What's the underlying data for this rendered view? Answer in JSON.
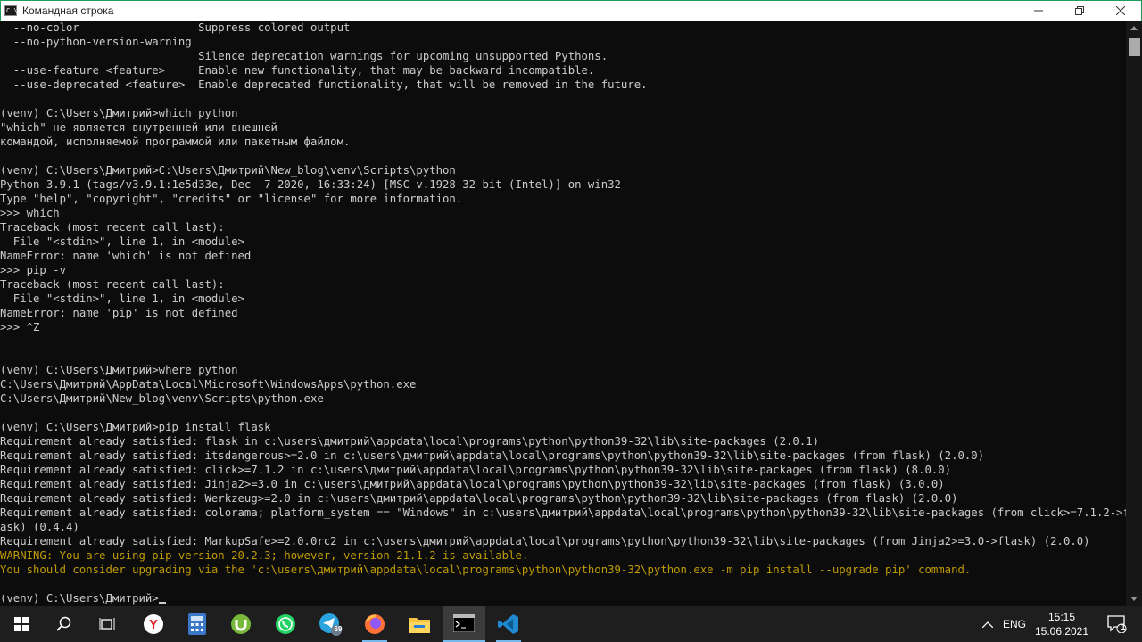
{
  "window": {
    "title": "Командная строка",
    "app_icon_text": "C:\\"
  },
  "terminal": {
    "lines": [
      {
        "text": "  --no-color                  Suppress colored output",
        "color": "#cccccc"
      },
      {
        "text": "  --no-python-version-warning",
        "color": "#cccccc"
      },
      {
        "text": "                              Silence deprecation warnings for upcoming unsupported Pythons.",
        "color": "#cccccc"
      },
      {
        "text": "  --use-feature <feature>     Enable new functionality, that may be backward incompatible.",
        "color": "#cccccc"
      },
      {
        "text": "  --use-deprecated <feature>  Enable deprecated functionality, that will be removed in the future.",
        "color": "#cccccc"
      },
      {
        "text": "",
        "color": "#cccccc"
      },
      {
        "text": "(venv) C:\\Users\\Дмитрий>which python",
        "color": "#cccccc"
      },
      {
        "text": "\"which\" не является внутренней или внешней",
        "color": "#cccccc"
      },
      {
        "text": "командой, исполняемой программой или пакетным файлом.",
        "color": "#cccccc"
      },
      {
        "text": "",
        "color": "#cccccc"
      },
      {
        "text": "(venv) C:\\Users\\Дмитрий>C:\\Users\\Дмитрий\\New_blog\\venv\\Scripts\\python",
        "color": "#cccccc"
      },
      {
        "text": "Python 3.9.1 (tags/v3.9.1:1e5d33e, Dec  7 2020, 16:33:24) [MSC v.1928 32 bit (Intel)] on win32",
        "color": "#cccccc"
      },
      {
        "text": "Type \"help\", \"copyright\", \"credits\" or \"license\" for more information.",
        "color": "#cccccc"
      },
      {
        "text": ">>> which",
        "color": "#cccccc"
      },
      {
        "text": "Traceback (most recent call last):",
        "color": "#cccccc"
      },
      {
        "text": "  File \"<stdin>\", line 1, in <module>",
        "color": "#cccccc"
      },
      {
        "text": "NameError: name 'which' is not defined",
        "color": "#cccccc"
      },
      {
        "text": ">>> pip -v",
        "color": "#cccccc"
      },
      {
        "text": "Traceback (most recent call last):",
        "color": "#cccccc"
      },
      {
        "text": "  File \"<stdin>\", line 1, in <module>",
        "color": "#cccccc"
      },
      {
        "text": "NameError: name 'pip' is not defined",
        "color": "#cccccc"
      },
      {
        "text": ">>> ^Z",
        "color": "#cccccc"
      },
      {
        "text": "",
        "color": "#cccccc"
      },
      {
        "text": "",
        "color": "#cccccc"
      },
      {
        "text": "(venv) C:\\Users\\Дмитрий>where python",
        "color": "#cccccc"
      },
      {
        "text": "C:\\Users\\Дмитрий\\AppData\\Local\\Microsoft\\WindowsApps\\python.exe",
        "color": "#cccccc"
      },
      {
        "text": "C:\\Users\\Дмитрий\\New_blog\\venv\\Scripts\\python.exe",
        "color": "#cccccc"
      },
      {
        "text": "",
        "color": "#cccccc"
      },
      {
        "text": "(venv) C:\\Users\\Дмитрий>pip install flask",
        "color": "#cccccc"
      },
      {
        "text": "Requirement already satisfied: flask in c:\\users\\дмитрий\\appdata\\local\\programs\\python\\python39-32\\lib\\site-packages (2.0.1)",
        "color": "#cccccc"
      },
      {
        "text": "Requirement already satisfied: itsdangerous>=2.0 in c:\\users\\дмитрий\\appdata\\local\\programs\\python\\python39-32\\lib\\site-packages (from flask) (2.0.0)",
        "color": "#cccccc"
      },
      {
        "text": "Requirement already satisfied: click>=7.1.2 in c:\\users\\дмитрий\\appdata\\local\\programs\\python\\python39-32\\lib\\site-packages (from flask) (8.0.0)",
        "color": "#cccccc"
      },
      {
        "text": "Requirement already satisfied: Jinja2>=3.0 in c:\\users\\дмитрий\\appdata\\local\\programs\\python\\python39-32\\lib\\site-packages (from flask) (3.0.0)",
        "color": "#cccccc"
      },
      {
        "text": "Requirement already satisfied: Werkzeug>=2.0 in c:\\users\\дмитрий\\appdata\\local\\programs\\python\\python39-32\\lib\\site-packages (from flask) (2.0.0)",
        "color": "#cccccc"
      },
      {
        "text": "Requirement already satisfied: colorama; platform_system == \"Windows\" in c:\\users\\дмитрий\\appdata\\local\\programs\\python\\python39-32\\lib\\site-packages (from click>=7.1.2->fl",
        "color": "#cccccc"
      },
      {
        "text": "ask) (0.4.4)",
        "color": "#cccccc"
      },
      {
        "text": "Requirement already satisfied: MarkupSafe>=2.0.0rc2 in c:\\users\\дмитрий\\appdata\\local\\programs\\python\\python39-32\\lib\\site-packages (from Jinja2>=3.0->flask) (2.0.0)",
        "color": "#cccccc"
      },
      {
        "text": "WARNING: You are using pip version 20.2.3; however, version 21.1.2 is available.",
        "color": "#c19c00"
      },
      {
        "text": "You should consider upgrading via the 'c:\\users\\дмитрий\\appdata\\local\\programs\\python\\python39-32\\python.exe -m pip install --upgrade pip' command.",
        "color": "#c19c00"
      },
      {
        "text": "",
        "color": "#cccccc"
      },
      {
        "text": "(venv) C:\\Users\\Дмитрий>",
        "color": "#cccccc",
        "cursor": true
      }
    ]
  },
  "taskbar": {
    "apps": [
      {
        "name": "task-view-icon",
        "open": false,
        "active": false
      },
      {
        "name": "yandex-browser-icon",
        "open": false,
        "active": false
      },
      {
        "name": "calculator-icon",
        "open": false,
        "active": false
      },
      {
        "name": "utorrent-icon",
        "open": false,
        "active": false
      },
      {
        "name": "whatsapp-icon",
        "open": false,
        "active": false
      },
      {
        "name": "telegram-icon",
        "open": false,
        "active": false,
        "badge": "69"
      },
      {
        "name": "firefox-icon",
        "open": true,
        "active": false
      },
      {
        "name": "file-explorer-icon",
        "open": false,
        "active": false
      },
      {
        "name": "command-prompt-icon",
        "open": true,
        "active": true
      },
      {
        "name": "vscode-icon",
        "open": true,
        "active": false
      }
    ],
    "tray": {
      "language": "ENG",
      "time": "15:15",
      "date": "15.06.2021",
      "notification_count": "1"
    }
  }
}
